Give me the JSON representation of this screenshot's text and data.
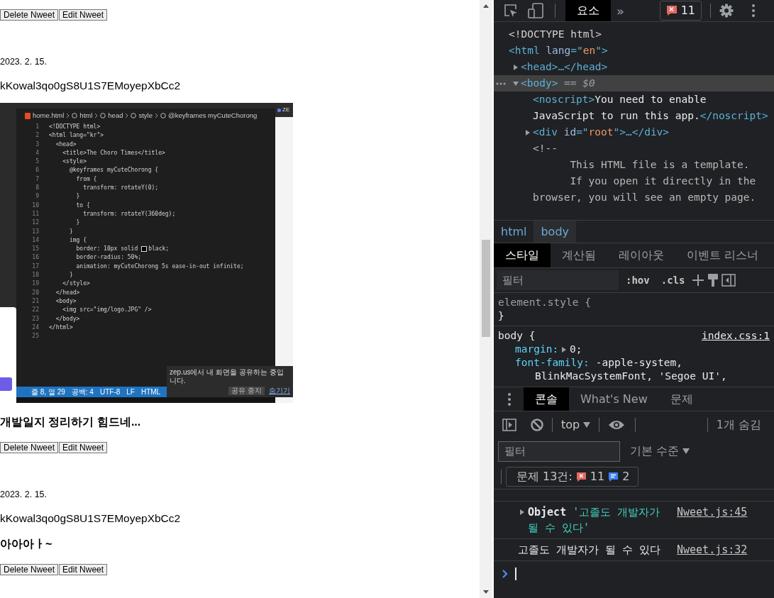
{
  "page": {
    "feed": [
      {
        "kind": "actions",
        "buttons": [
          "Delete Nweet",
          "Edit Nweet"
        ]
      },
      {
        "kind": "date",
        "text": "2023. 2. 15."
      },
      {
        "kind": "creator",
        "text": "kKowal3qo0gS8U1S7EMoyepXbCc2"
      },
      {
        "kind": "screenshot",
        "editor": {
          "tab": "ZE",
          "breadcrumb": [
            "home.html",
            "html",
            "head",
            "style",
            "@keyframes myCuteChorong"
          ],
          "lines": [
            {
              "n": "1",
              "code": "<!DOCTYPE html>"
            },
            {
              "n": "2",
              "code": "<html lang=\"kr\">"
            },
            {
              "n": "3",
              "code": "  <head>"
            },
            {
              "n": "4",
              "code": "    <title>The Choro Times</title>"
            },
            {
              "n": "5",
              "code": "    <style>"
            },
            {
              "n": "6",
              "code": "      @keyframes myCuteChorong {"
            },
            {
              "n": "7",
              "code": "        from {"
            },
            {
              "n": "8",
              "code": "          transform: rotateY(0);"
            },
            {
              "n": "9",
              "code": "        }"
            },
            {
              "n": "10",
              "code": "        to {"
            },
            {
              "n": "11",
              "code": "          transform: rotateY(360deg);"
            },
            {
              "n": "12",
              "code": "        }"
            },
            {
              "n": "13",
              "code": "      }"
            },
            {
              "n": "14",
              "code": "      img {"
            },
            {
              "n": "15",
              "code": "        border: 10px solid",
              "color": "#000000",
              "after": "black;"
            },
            {
              "n": "16",
              "code": "        border-radius: 50%;"
            },
            {
              "n": "17",
              "code": "        animation: myCuteChorong 5s ease-in-out infinite;"
            },
            {
              "n": "18",
              "code": "      }"
            },
            {
              "n": "19",
              "code": "    </style>"
            },
            {
              "n": "20",
              "code": "  </head>"
            },
            {
              "n": "21",
              "code": "  <body>"
            },
            {
              "n": "22",
              "code": "    <img src=\"img/logo.JPG\" />"
            },
            {
              "n": "23",
              "code": "  </body>"
            },
            {
              "n": "24",
              "code": "</html>"
            },
            {
              "n": "25"
            }
          ],
          "status": [
            "줄 8, 열 29",
            "공백: 4",
            "UTF-8",
            "LF",
            "HTML"
          ],
          "notice": {
            "text": "zep.us에서 내 화면을 공유하는 중입니다.",
            "buttons": [
              "공유 중지",
              "숨기기"
            ]
          }
        }
      },
      {
        "kind": "nweet",
        "text": "개발일지 정리하기 힘드네..."
      },
      {
        "kind": "actions",
        "buttons": [
          "Delete Nweet",
          "Edit Nweet"
        ]
      },
      {
        "kind": "date",
        "text": "2023. 2. 15."
      },
      {
        "kind": "creator",
        "text": "kKowal3qo0gS8U1S7EMoyepXbCc2"
      },
      {
        "kind": "nweet",
        "text": "아아아ㅏ~"
      },
      {
        "kind": "actions",
        "buttons": [
          "Delete Nweet",
          "Edit Nweet"
        ]
      }
    ]
  },
  "devtools": {
    "toolbar": {
      "tabs": [
        {
          "label": "요소",
          "selected": true
        }
      ],
      "more": "»",
      "errors": "11"
    },
    "dom_tree": [
      {
        "selected": false,
        "lines": [
          [
            {
              "text": "<!DOCTYPE html>",
              "kind": "dim"
            }
          ]
        ]
      },
      {
        "selected": false,
        "lines": [
          [
            {
              "text": "<html",
              "kind": "tag"
            },
            {
              "text": " lang",
              "kind": "attr"
            },
            {
              "text": "=\"",
              "kind": "tag"
            },
            {
              "text": "en",
              "kind": "value"
            },
            {
              "text": "\">",
              "kind": "tag"
            }
          ]
        ],
        "children": [
          {
            "selected": false,
            "expanded": false,
            "lines": [
              [
                {
                  "text": "<head>…</head>",
                  "kind": "tag"
                }
              ]
            ]
          },
          {
            "selected": true,
            "expanded": true,
            "lines": [
              [
                {
                  "text": "<body>",
                  "kind": "tag"
                },
                {
                  "text": " == $0",
                  "kind": "hint"
                }
              ]
            ],
            "children": [
              {
                "selected": false,
                "lines": [
                  [
                    {
                      "text": "<noscript>",
                      "kind": "tag"
                    },
                    {
                      "text": "You need to enable",
                      "kind": "text"
                    }
                  ],
                  [
                    {
                      "text": "JavaScript to run this app.",
                      "kind": "text"
                    },
                    {
                      "text": "</noscript>",
                      "kind": "tag"
                    }
                  ]
                ]
              },
              {
                "selected": false,
                "expanded": false,
                "lines": [
                  [
                    {
                      "text": "<div",
                      "kind": "tag"
                    },
                    {
                      "text": " id",
                      "kind": "attr"
                    },
                    {
                      "text": "=\"",
                      "kind": "tag"
                    },
                    {
                      "text": "root",
                      "kind": "value"
                    },
                    {
                      "text": "\">…</div>",
                      "kind": "tag"
                    }
                  ]
                ]
              },
              {
                "selected": false,
                "lines": [
                  [
                    {
                      "text": "<!--",
                      "kind": "comment"
                    }
                  ],
                  [
                    {
                      "text": "      This HTML file is a template.",
                      "kind": "comment"
                    }
                  ],
                  [
                    {
                      "text": "      If you open it directly in the",
                      "kind": "comment"
                    }
                  ],
                  [
                    {
                      "text": "browser, you will see an empty page.",
                      "kind": "comment"
                    }
                  ]
                ]
              }
            ]
          }
        ]
      }
    ],
    "breadcrumbs": [
      {
        "label": "html",
        "selected": false
      },
      {
        "label": "body",
        "selected": true
      }
    ],
    "styles_tabs": [
      {
        "label": "스타일",
        "selected": true
      },
      {
        "label": "계산됨",
        "selected": false
      },
      {
        "label": "레이아웃",
        "selected": false
      },
      {
        "label": "이벤트 리스너",
        "selected": false
      }
    ],
    "styles_filter": {
      "placeholder": "필터",
      "toggles": [
        ":hov",
        ".cls"
      ]
    },
    "rules": [
      {
        "selector": "element.style {",
        "dim": true,
        "close": "}"
      },
      {
        "selector": "body {",
        "dim": false,
        "source": "index.css:1",
        "declarations": [
          {
            "property": "margin:",
            "expandable": true,
            "value": [
              "0;"
            ]
          },
          {
            "property": "font-family:",
            "expandable": false,
            "value": [
              "-apple-system,",
              "BlinkMacSystemFont, 'Segoe UI',"
            ]
          }
        ]
      }
    ],
    "drawer_tabs": [
      {
        "label": "콘솔",
        "selected": true
      },
      {
        "label": "What's New",
        "selected": false
      },
      {
        "label": "문제",
        "selected": false
      }
    ],
    "console": {
      "context": "top",
      "hidden": "1개 숨김",
      "filter_placeholder": "필터",
      "level": "기본 수준",
      "issues": {
        "label": "문제 13건:",
        "errors": "11",
        "infos": "2"
      },
      "messages": [
        {
          "kind": "object",
          "expanded": false,
          "label": "Object",
          "value": "'고졸도 개발자가 될 수 있다'",
          "source": "Nweet.js:45"
        },
        {
          "kind": "log",
          "text": "고졸도 개발자가 될 수 있다",
          "source": "Nweet.js:32"
        }
      ]
    }
  }
}
